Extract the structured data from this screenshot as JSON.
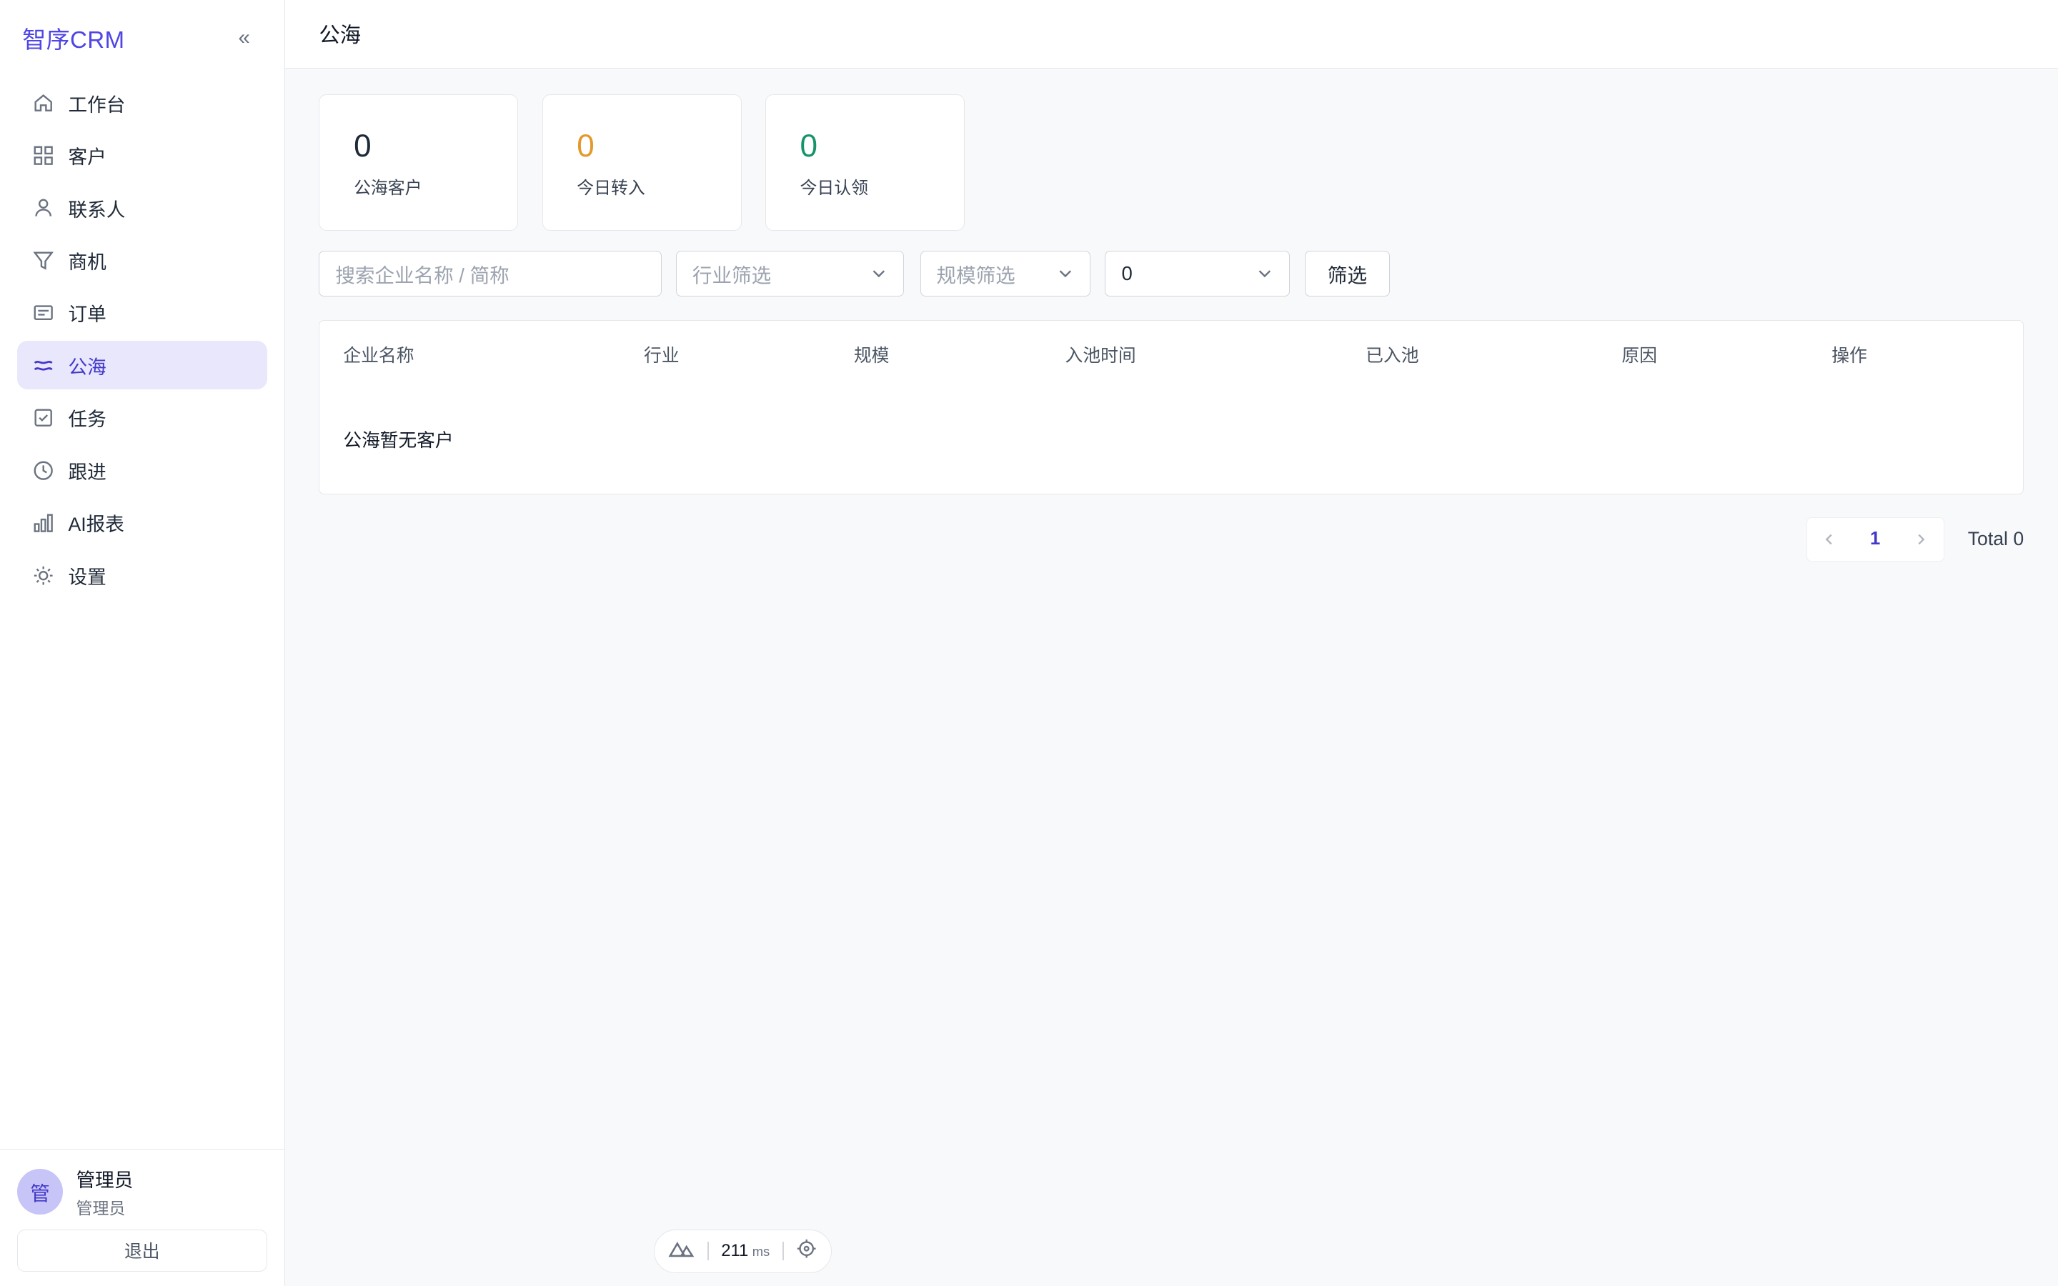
{
  "app": {
    "title": "智序CRM",
    "collapse_label": "«"
  },
  "sidebar": {
    "items": [
      {
        "label": "工作台",
        "icon": "home-icon"
      },
      {
        "label": "客户",
        "icon": "grid-icon"
      },
      {
        "label": "联系人",
        "icon": "user-icon"
      },
      {
        "label": "商机",
        "icon": "funnel-icon"
      },
      {
        "label": "订单",
        "icon": "receipt-icon"
      },
      {
        "label": "公海",
        "icon": "waves-icon",
        "active": true
      },
      {
        "label": "任务",
        "icon": "checkbox-icon"
      },
      {
        "label": "跟进",
        "icon": "clock-icon"
      },
      {
        "label": "AI报表",
        "icon": "bar-chart-icon"
      },
      {
        "label": "设置",
        "icon": "sun-gear-icon"
      }
    ],
    "user": {
      "avatar": "管",
      "name": "管理员",
      "role": "管理员"
    },
    "logout_label": "退出"
  },
  "page": {
    "title": "公海"
  },
  "stats": [
    {
      "value": "0",
      "label": "公海客户",
      "color": "#1f2937"
    },
    {
      "value": "0",
      "label": "今日转入",
      "color": "#e29a2b"
    },
    {
      "value": "0",
      "label": "今日认领",
      "color": "#17936b"
    }
  ],
  "filters": {
    "search_placeholder": "搜索企业名称 / 简称",
    "industry_placeholder": "行业筛选",
    "scale_placeholder": "规模筛选",
    "days_value": "0",
    "filter_button": "筛选"
  },
  "table": {
    "columns": [
      "企业名称",
      "行业",
      "规模",
      "入池时间",
      "已入池",
      "原因",
      "操作"
    ],
    "empty_text": "公海暂无客户"
  },
  "pagination": {
    "current_page": "1",
    "total_label": "Total 0"
  },
  "devtools": {
    "time": "211",
    "unit": "ms"
  },
  "colors": {
    "accent": "#4f46e5",
    "active_bg": "#e8e7fb"
  }
}
